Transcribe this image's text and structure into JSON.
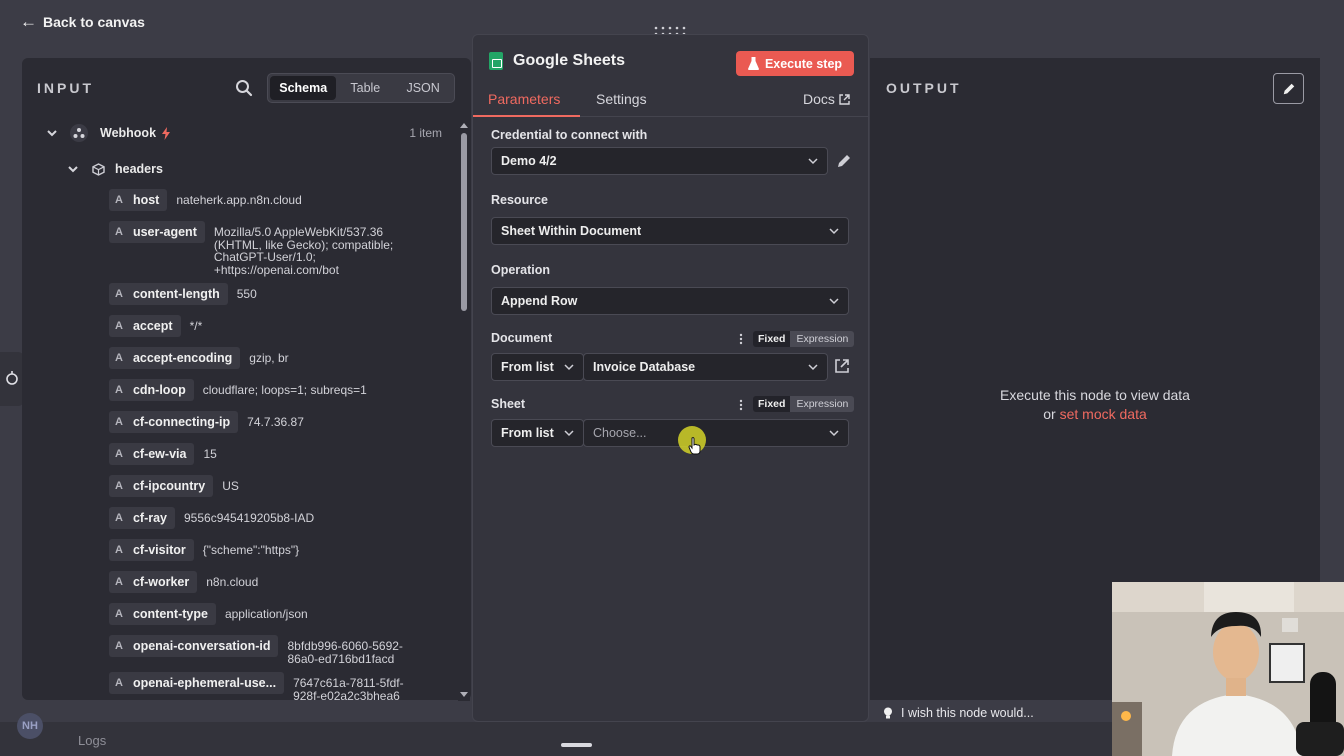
{
  "topbar": {
    "back_label": "Back to canvas"
  },
  "input_panel": {
    "title": "INPUT",
    "view_tabs": [
      "Schema",
      "Table",
      "JSON"
    ],
    "active_view": "Schema",
    "root_node": {
      "label": "Webhook",
      "count": "1 item"
    },
    "group_label": "headers",
    "fields": [
      {
        "key": "host",
        "value": "nateherk.app.n8n.cloud"
      },
      {
        "key": "user-agent",
        "value": "Mozilla/5.0 AppleWebKit/537.36\n(KHTML, like Gecko); compatible;\nChatGPT-User/1.0;\n+https://openai.com/bot"
      },
      {
        "key": "content-length",
        "value": "550"
      },
      {
        "key": "accept",
        "value": "*/*"
      },
      {
        "key": "accept-encoding",
        "value": "gzip, br"
      },
      {
        "key": "cdn-loop",
        "value": "cloudflare; loops=1; subreqs=1"
      },
      {
        "key": "cf-connecting-ip",
        "value": "74.7.36.87"
      },
      {
        "key": "cf-ew-via",
        "value": "15"
      },
      {
        "key": "cf-ipcountry",
        "value": "US"
      },
      {
        "key": "cf-ray",
        "value": "9556c945419205b8-IAD"
      },
      {
        "key": "cf-visitor",
        "value": "{\"scheme\":\"https\"}"
      },
      {
        "key": "cf-worker",
        "value": "n8n.cloud"
      },
      {
        "key": "content-type",
        "value": "application/json"
      },
      {
        "key": "openai-conversation-id",
        "value": "8bfdb996-6060-5692-\n86a0-ed716bd1facd"
      },
      {
        "key": "openai-ephemeral-use...",
        "value": "7647c61a-7811-5fdf-\n928f-e02a2c3bhea6"
      }
    ]
  },
  "node_panel": {
    "title": "Google Sheets",
    "execute_label": "Execute step",
    "tabs": {
      "parameters": "Parameters",
      "settings": "Settings",
      "docs": "Docs"
    },
    "credential": {
      "label": "Credential to connect with",
      "value": "Demo 4/2"
    },
    "resource": {
      "label": "Resource",
      "value": "Sheet Within Document"
    },
    "operation": {
      "label": "Operation",
      "value": "Append Row"
    },
    "document": {
      "label": "Document",
      "mode": "From list",
      "value": "Invoice Database",
      "fixed": "Fixed",
      "expression": "Expression"
    },
    "sheet": {
      "label": "Sheet",
      "mode": "From list",
      "placeholder": "Choose...",
      "fixed": "Fixed",
      "expression": "Expression"
    }
  },
  "output_panel": {
    "title": "OUTPUT",
    "empty_line1": "Execute this node to view data",
    "empty_or": "or",
    "mock_link": "set mock data"
  },
  "footer": {
    "wish_label": "I wish this node would...",
    "avatar_initials": "NH",
    "logs_label": "Logs"
  },
  "colors": {
    "accent": "#f06a60",
    "execute": "#ea5a52",
    "sheets_green": "#23a566"
  }
}
